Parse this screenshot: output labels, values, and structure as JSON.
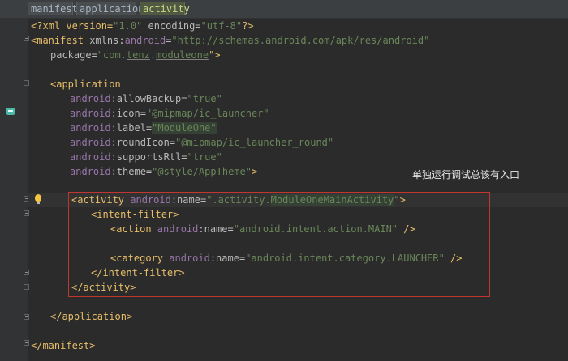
{
  "breadcrumbs": [
    "manifest",
    "application",
    "activity"
  ],
  "annotation": "单独运行调试总该有入口",
  "code": {
    "l1": {
      "a": "<?xml version=",
      "b": "\"1.0\"",
      "c": " encoding=",
      "d": "\"utf-8\"",
      "e": "?>"
    },
    "l2": {
      "a": "<manifest",
      "b": " xmlns:",
      "c": "android",
      "d": "=",
      "e": "\"http://schemas.android.com/apk/res/android\""
    },
    "l3": {
      "a": "package=",
      "b": "\"com.",
      "c": "tenz",
      "d": ".",
      "e": "moduleone",
      "f": "\">"
    },
    "l4": {
      "a": "<application"
    },
    "l5": {
      "ns": "android",
      "attr": ":allowBackup=",
      "val": "\"true\""
    },
    "l6": {
      "ns": "android",
      "attr": ":icon=",
      "val": "\"@mipmap/ic_launcher\""
    },
    "l7": {
      "ns": "android",
      "attr": ":label=",
      "val": "\"ModuleOne\""
    },
    "l8": {
      "ns": "android",
      "attr": ":roundIcon=",
      "val": "\"@mipmap/ic_launcher_round\""
    },
    "l9": {
      "ns": "android",
      "attr": ":supportsRtl=",
      "val": "\"true\""
    },
    "l10": {
      "ns": "android",
      "attr": ":theme=",
      "val": "\"@style/AppTheme\"",
      "end": ">"
    },
    "l11": {
      "a": "<activity",
      "ns": " android",
      "attr": ":name=",
      "v1": "\".activity.",
      "v2": "ModuleOneMainActivity",
      "v3": "\"",
      "end": ">"
    },
    "l12": {
      "a": "<intent-filter>"
    },
    "l13": {
      "a": "<action",
      "ns": " android",
      "attr": ":name=",
      "val": "\"android.intent.action.MAIN\"",
      "end": " />"
    },
    "l14": {
      "a": "<category",
      "ns": " android",
      "attr": ":name=",
      "val": "\"android.intent.category.LAUNCHER\"",
      "end": " />"
    },
    "l15": {
      "a": "</intent-filter>"
    },
    "l16": {
      "a": "</activity>"
    },
    "l17": {
      "a": "</application>"
    },
    "l18": {
      "a": "</manifest>"
    }
  }
}
